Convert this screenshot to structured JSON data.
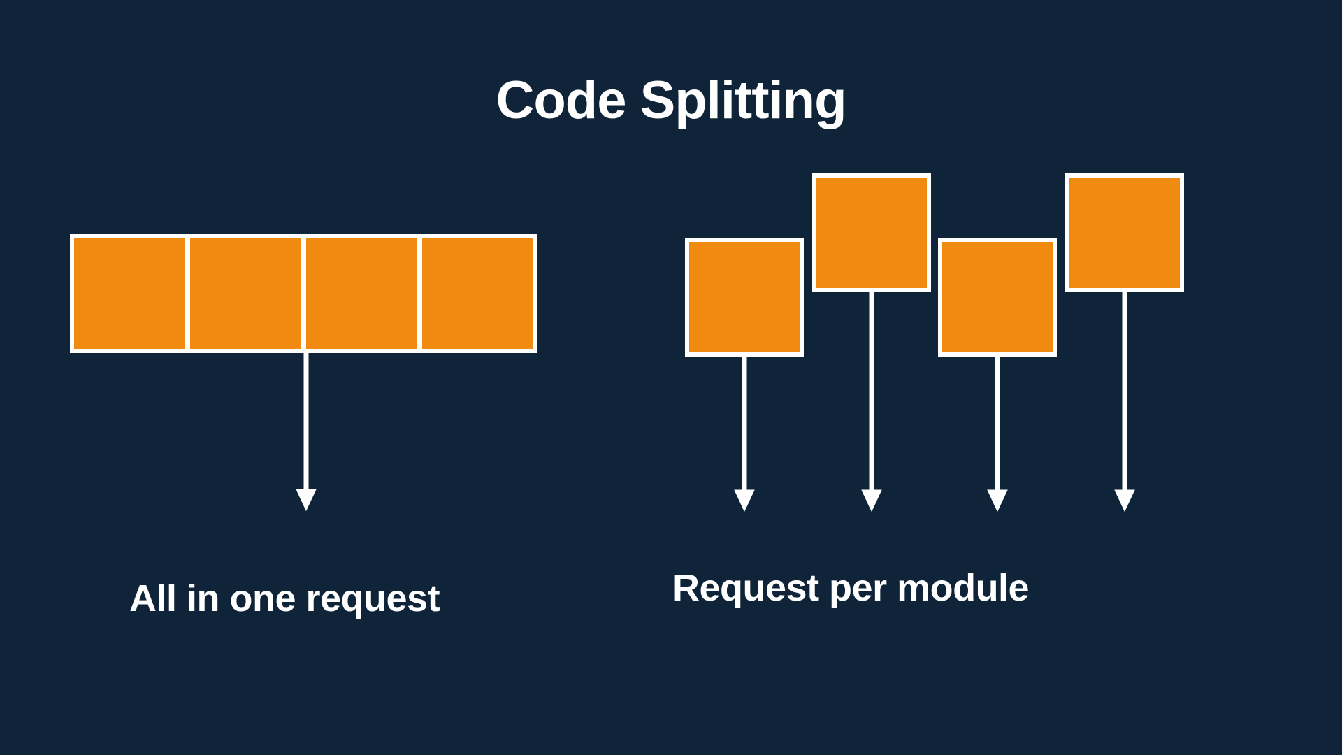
{
  "title": "Code Splitting",
  "left": {
    "caption": "All in one request"
  },
  "right": {
    "caption": "Request per module"
  },
  "colors": {
    "bg": "#0f2438",
    "box": "#f08a11",
    "border": "#ffffff",
    "text": "#ffffff"
  }
}
